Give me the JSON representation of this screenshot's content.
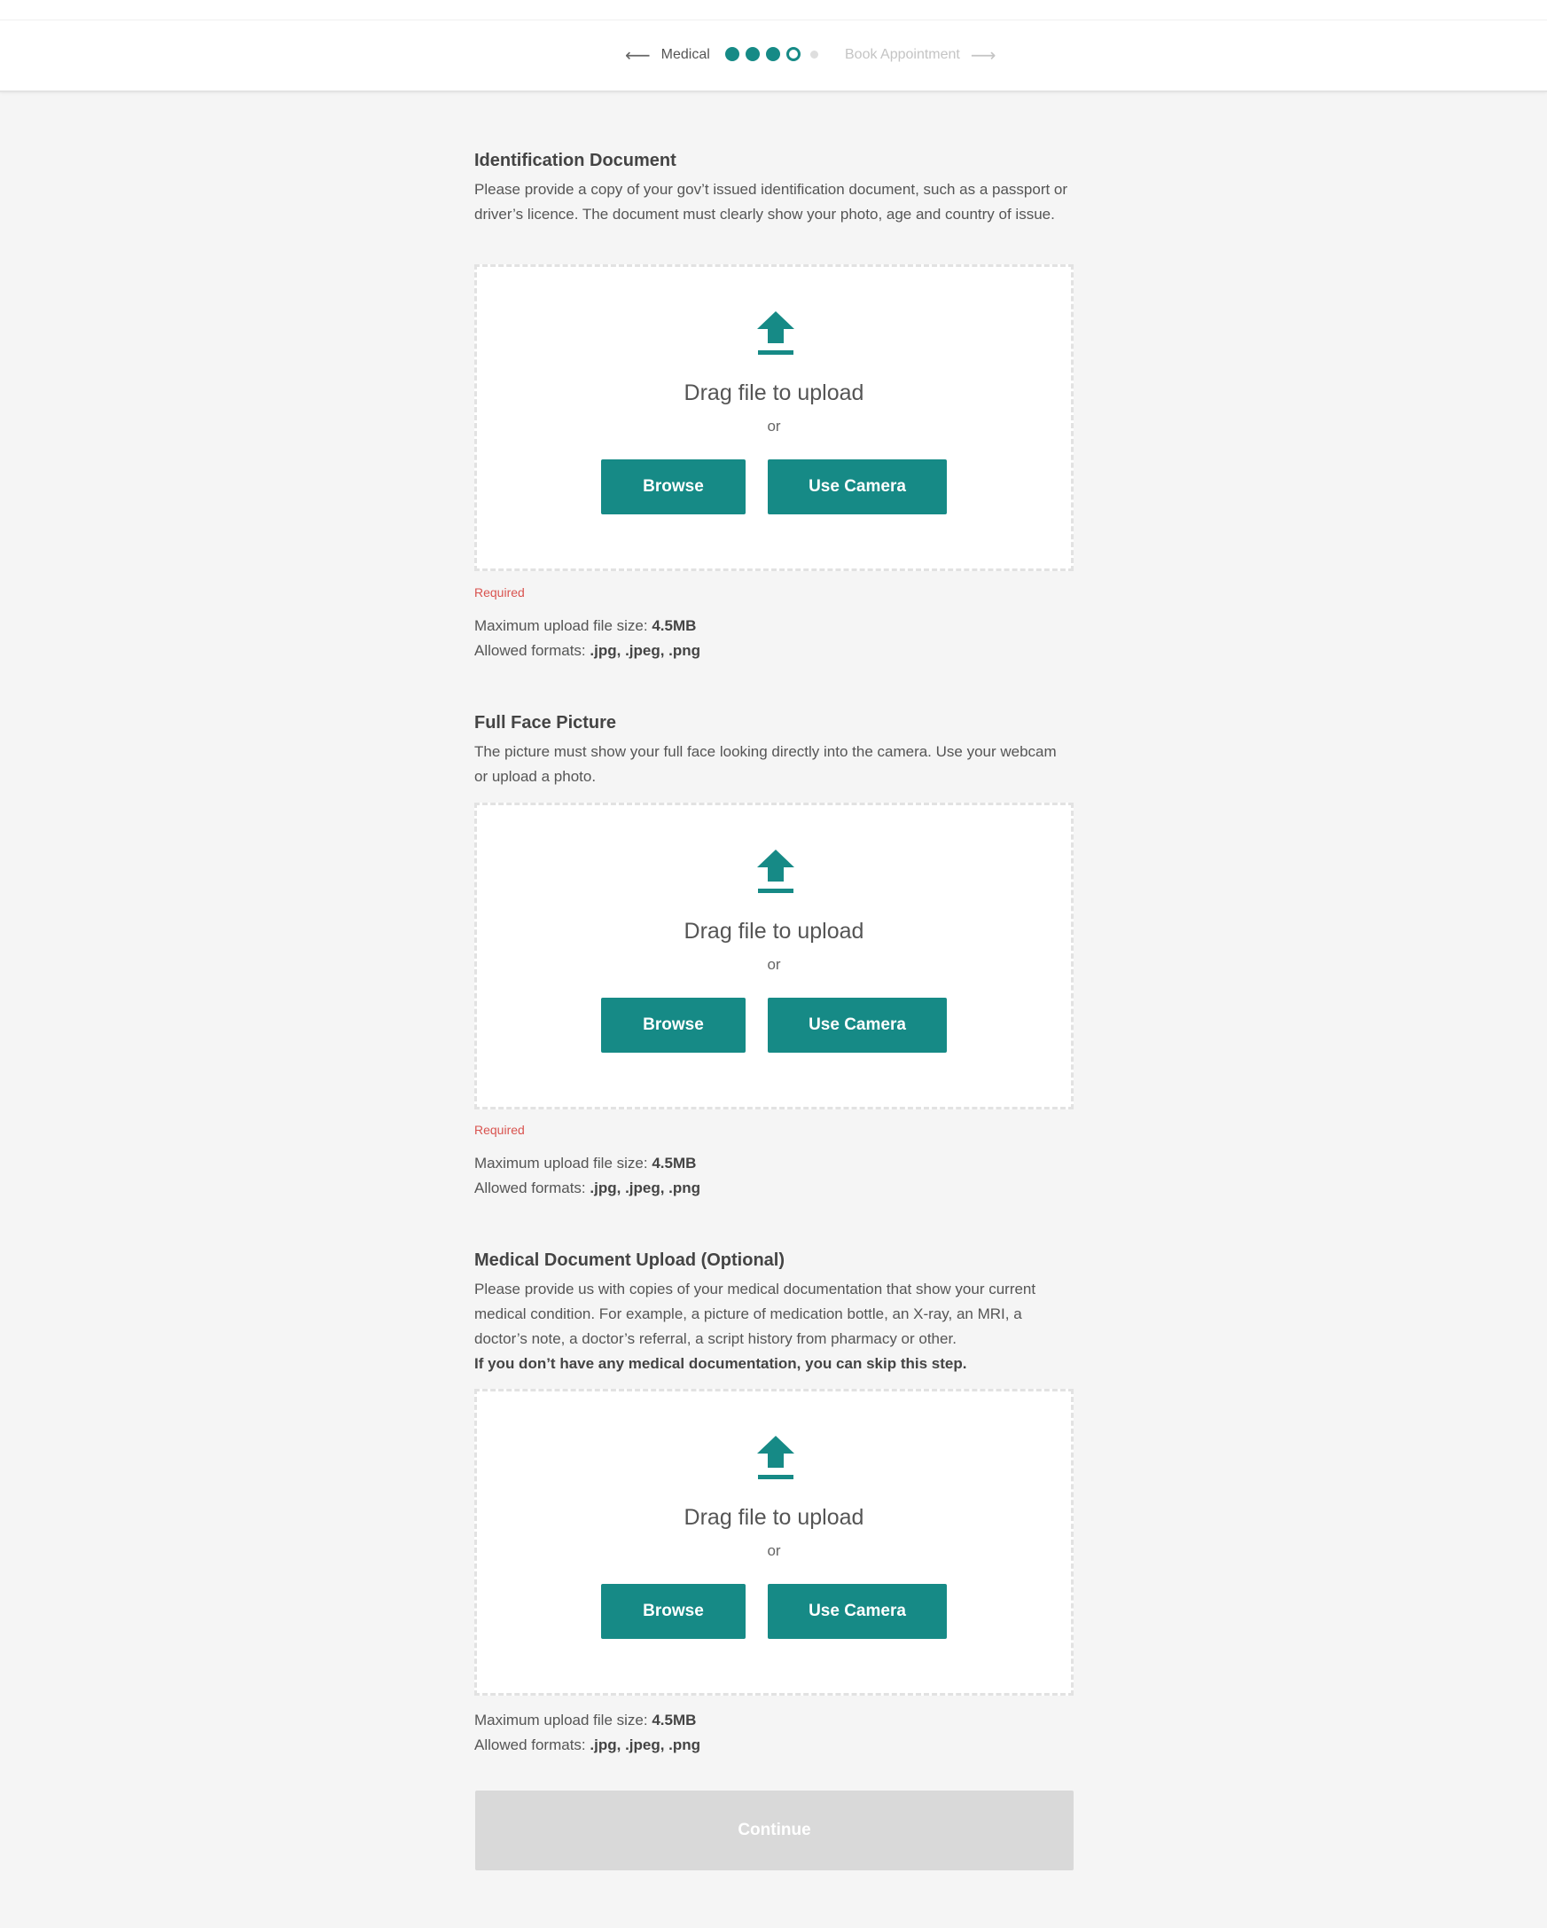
{
  "nav": {
    "back_label": "Medical",
    "next_label": "Book Appointment",
    "steps_completed": 3,
    "current_step": 4,
    "total_steps": 5
  },
  "colors": {
    "accent": "#168a86",
    "required": "#d9534f",
    "disabled_button": "#d9d9d9",
    "background": "#f5f5f5"
  },
  "sections": [
    {
      "title": "Identification Document",
      "description": "Please provide a copy of your gov’t issued identification document, such as a passport or driver’s licence. The document must clearly show your photo, age and country of issue.",
      "description_bold": "",
      "icon": "upload-icon",
      "drag_text": "Drag file to upload",
      "or_text": "or",
      "browse_label": "Browse",
      "camera_label": "Use Camera",
      "required_text": "Required",
      "max_size_label": "Maximum upload file size:",
      "max_size_value": "4.5MB",
      "formats_label": "Allowed formats:",
      "formats_value": ".jpg, .jpeg, .png"
    },
    {
      "title": "Full Face Picture",
      "description": "The picture must show your full face looking directly into the camera. Use your webcam or upload a photo.",
      "description_bold": "",
      "icon": "upload-icon",
      "drag_text": "Drag file to upload",
      "or_text": "or",
      "browse_label": "Browse",
      "camera_label": "Use Camera",
      "required_text": "Required",
      "max_size_label": "Maximum upload file size:",
      "max_size_value": "4.5MB",
      "formats_label": "Allowed formats:",
      "formats_value": ".jpg, .jpeg, .png"
    },
    {
      "title": "Medical Document Upload (Optional)",
      "description": "Please provide us with copies of your medical documentation that show your current medical condition. For example, a picture of medication bottle, an X-ray, an MRI, a doctor’s note, a doctor’s referral, a script history from pharmacy or other.",
      "description_bold": "If you don’t have any medical documentation, you can skip this step.",
      "icon": "upload-icon",
      "drag_text": "Drag file to upload",
      "or_text": "or",
      "browse_label": "Browse",
      "camera_label": "Use Camera",
      "max_size_label": "Maximum upload file size:",
      "max_size_value": "4.5MB",
      "formats_label": "Allowed formats:",
      "formats_value": ".jpg, .jpeg, .png"
    }
  ],
  "continue_label": "Continue"
}
